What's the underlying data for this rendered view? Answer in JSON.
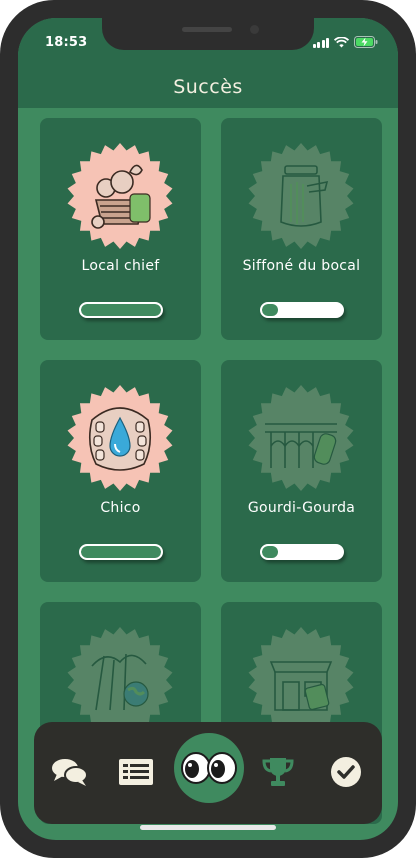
{
  "status_bar": {
    "time": "18:53"
  },
  "header": {
    "title": "Succès"
  },
  "achievements": [
    {
      "label": "Local chief",
      "progress": 1.0,
      "unlocked": true,
      "icon": "vegetable-basket-icon"
    },
    {
      "label": "Siffoné du bocal",
      "progress": 0.2,
      "unlocked": false,
      "icon": "jar-icon"
    },
    {
      "label": "Chico",
      "progress": 1.0,
      "unlocked": true,
      "icon": "teeth-water-drop-icon"
    },
    {
      "label": "Gourdi-Gourda",
      "progress": 0.2,
      "unlocked": false,
      "icon": "aqueduct-bottle-icon"
    },
    {
      "label": "",
      "progress": 0,
      "unlocked": false,
      "icon": "forest-earth-icon"
    },
    {
      "label": "",
      "progress": 0,
      "unlocked": false,
      "icon": "shop-bag-icon"
    }
  ],
  "tabbar": {
    "items": [
      {
        "name": "chat-icon"
      },
      {
        "name": "list-icon"
      },
      {
        "name": "eyes-icon",
        "active": true
      },
      {
        "name": "trophy-icon"
      },
      {
        "name": "checkmark-icon"
      }
    ]
  },
  "colors": {
    "background": "#3f8a5f",
    "card": "#2b6a4b",
    "badge_unlocked": "#f6c3b5",
    "tabbar": "#2e2e2a",
    "accent_text": "#f3efe0"
  }
}
